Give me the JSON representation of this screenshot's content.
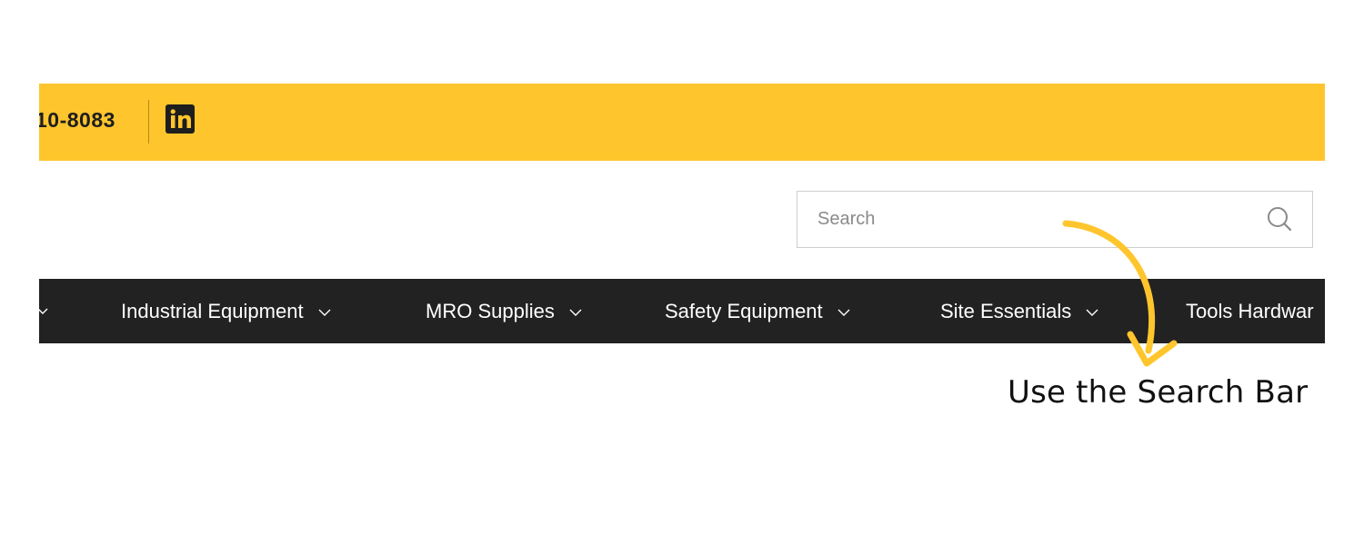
{
  "topbar": {
    "phone": "10-8083",
    "linkedin_icon": "linkedin-icon",
    "accent_color": "#ffc52d"
  },
  "header": {
    "search": {
      "placeholder": "Search",
      "value": "",
      "icon": "search-icon"
    }
  },
  "nav": {
    "background": "#222222",
    "items": [
      {
        "label": "Industrial Equipment"
      },
      {
        "label": "MRO Supplies"
      },
      {
        "label": "Safety Equipment"
      },
      {
        "label": "Site Essentials"
      },
      {
        "label": "Tools Hardwar"
      }
    ]
  },
  "annotation": {
    "text": "Use the Search Bar",
    "arrow_color": "#ffc52d"
  }
}
